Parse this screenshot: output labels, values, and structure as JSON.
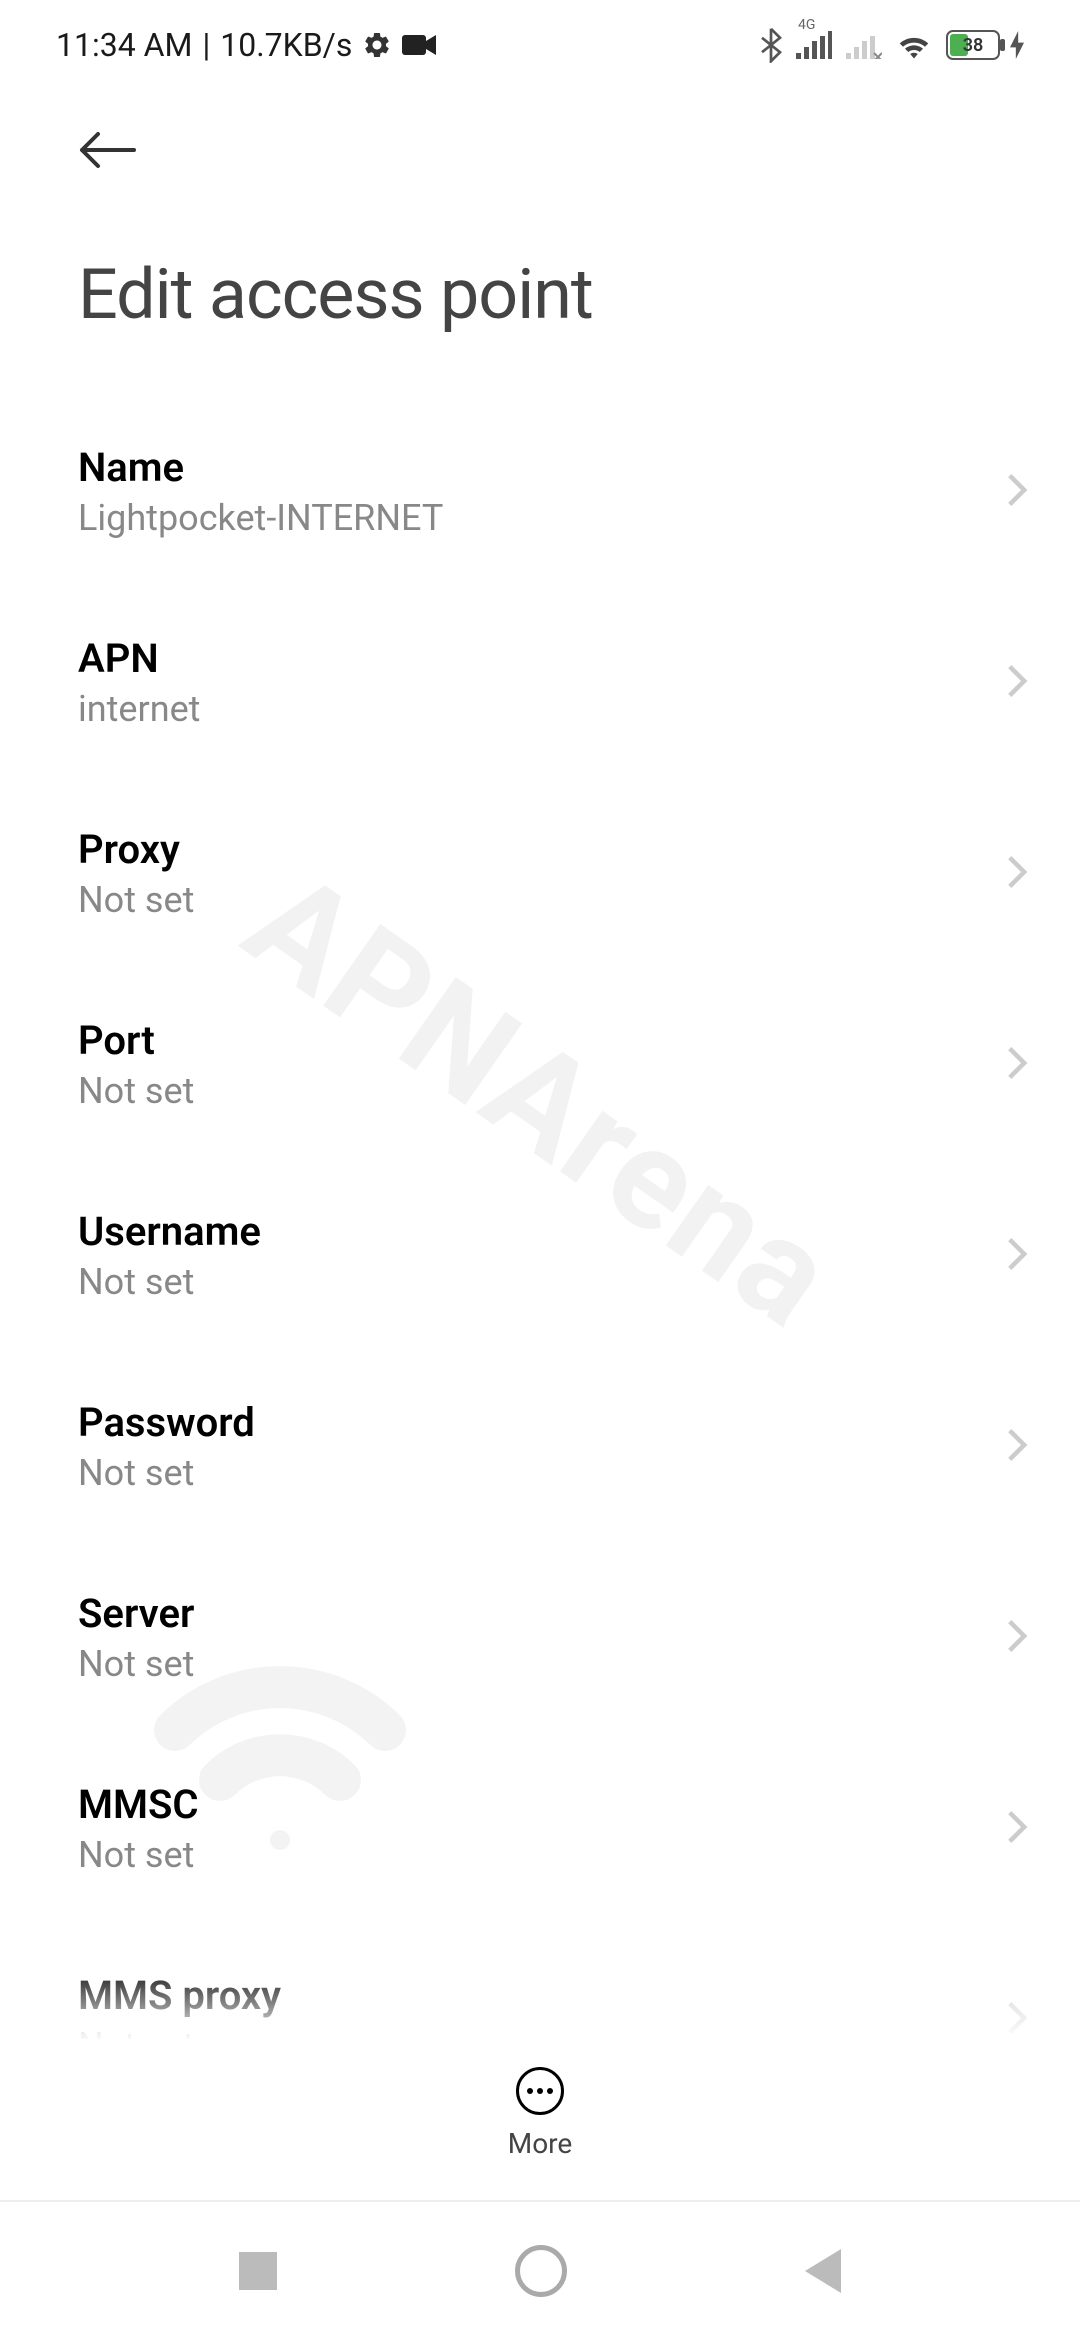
{
  "status": {
    "time": "11:34 AM",
    "speed": "10.7KB/s",
    "battery": "38",
    "network_type": "4G"
  },
  "page": {
    "title": "Edit access point"
  },
  "settings": [
    {
      "label": "Name",
      "value": "Lightpocket-INTERNET"
    },
    {
      "label": "APN",
      "value": "internet"
    },
    {
      "label": "Proxy",
      "value": "Not set"
    },
    {
      "label": "Port",
      "value": "Not set"
    },
    {
      "label": "Username",
      "value": "Not set"
    },
    {
      "label": "Password",
      "value": "Not set"
    },
    {
      "label": "Server",
      "value": "Not set"
    },
    {
      "label": "MMSC",
      "value": "Not set"
    },
    {
      "label": "MMS proxy",
      "value": "Not set"
    }
  ],
  "bottom": {
    "more_label": "More"
  },
  "watermark": "APNArena"
}
